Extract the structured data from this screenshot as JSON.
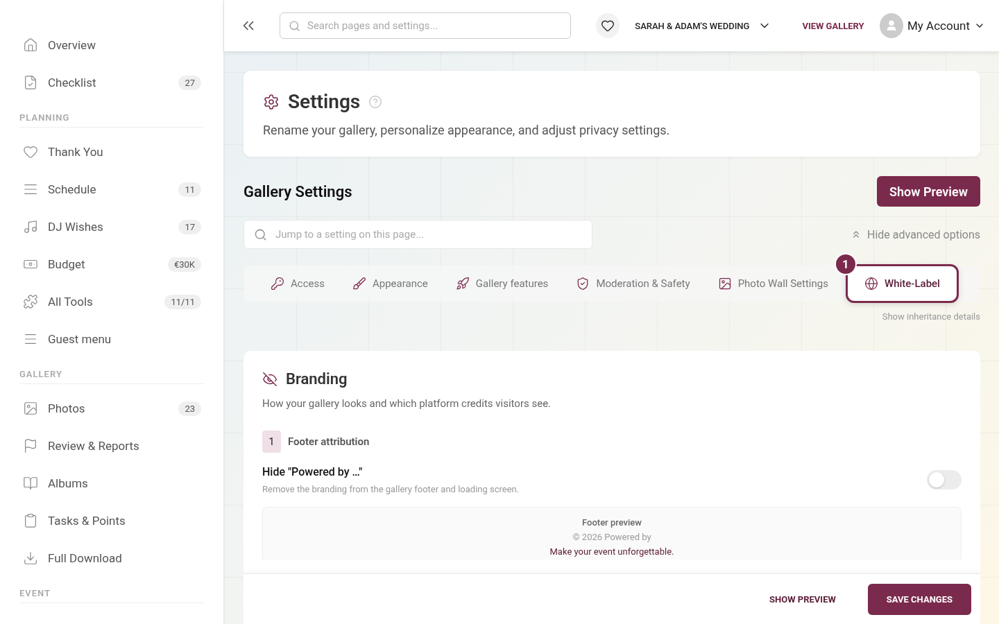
{
  "sidebar": {
    "groups": [
      {
        "items": [
          {
            "label": "Overview"
          },
          {
            "label": "Checklist",
            "count": "27"
          }
        ]
      },
      {
        "heading": "PLANNING",
        "items": [
          {
            "label": "Thank You"
          },
          {
            "label": "Schedule",
            "count": "11"
          },
          {
            "label": "DJ Wishes",
            "count": "17"
          },
          {
            "label": "Budget",
            "count": "€30K"
          },
          {
            "label": "All Tools",
            "count": "11/11"
          },
          {
            "label": "Guest menu"
          }
        ]
      },
      {
        "heading": "GALLERY",
        "items": [
          {
            "label": "Photos",
            "count": "23"
          },
          {
            "label": "Review & Reports"
          },
          {
            "label": "Albums"
          },
          {
            "label": "Tasks & Points"
          },
          {
            "label": "Full Download"
          }
        ]
      },
      {
        "heading": "EVENT"
      }
    ]
  },
  "topbar": {
    "search": {
      "placeholder": "Search pages and settings..."
    },
    "event": "SARAH & ADAM'S WEDDING",
    "view_gallery": "VIEW GALLERY",
    "account": "My Account"
  },
  "header": {
    "title": "Settings",
    "subtitle": "Rename your gallery, personalize appearance, and adjust privacy settings."
  },
  "gallery_settings": {
    "title": "Gallery Settings",
    "show_preview": "Show Preview",
    "search": {
      "placeholder": "Jump to a setting on this page..."
    },
    "advanced": "Hide advanced options",
    "inheritance": "Show inheritance details"
  },
  "tabs": [
    {
      "label": "Access",
      "selected": false
    },
    {
      "label": "Appearance",
      "selected": false
    },
    {
      "label": "Gallery features",
      "selected": false
    },
    {
      "label": "Moderation & Safety",
      "selected": false
    },
    {
      "label": "Photo Wall Settings",
      "selected": false
    },
    {
      "label": "White-Label",
      "selected": true,
      "badge": "1"
    }
  ],
  "branding": {
    "title": "Branding",
    "subtitle": "How your gallery looks and which platform credits visitors see.",
    "section_number": "1",
    "section_title": "Footer attribution",
    "setting": {
      "label": "Hide \"Powered by …\"",
      "hint": "Remove the branding from the gallery footer and loading screen.",
      "on": false
    },
    "preview": {
      "title": "Footer preview",
      "line": "© 2026 Powered by",
      "tagline": "Make your event unforgettable."
    }
  },
  "actions": {
    "preview": "SHOW PREVIEW",
    "save": "SAVE CHANGES"
  }
}
